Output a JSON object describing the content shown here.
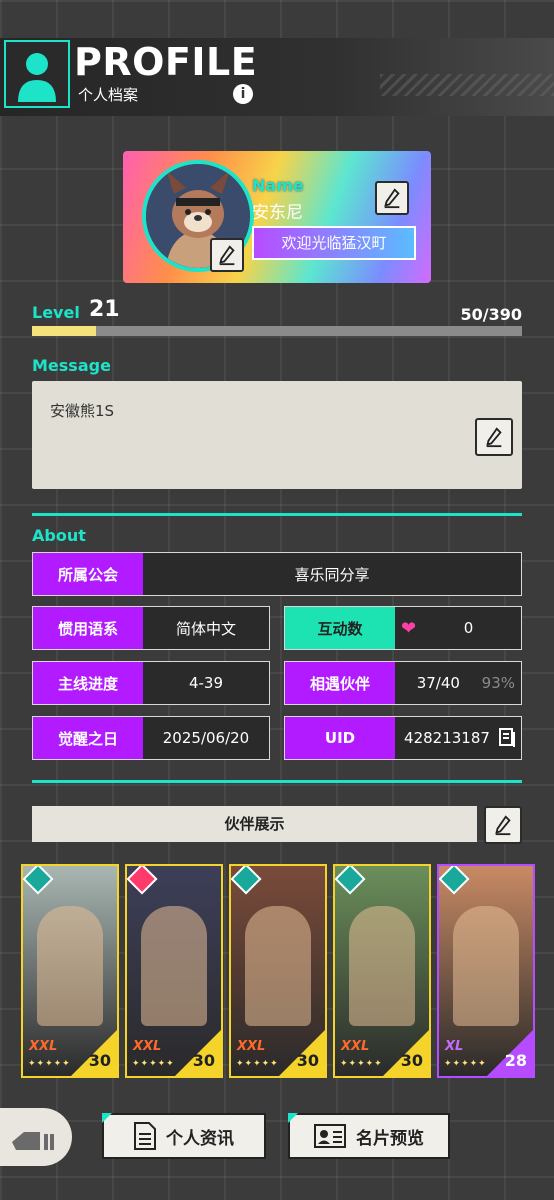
{
  "header": {
    "title": "PROFILE",
    "subtitle": "个人档案",
    "info_glyph": "i"
  },
  "name_card": {
    "name_label": "Name",
    "name_value": "安东尼",
    "greeting": "欢迎光临猛汉町"
  },
  "level": {
    "label": "Level",
    "value": "21",
    "exp_text": "50/390",
    "exp_fraction": 0.13
  },
  "message": {
    "label": "Message",
    "text": "安徽熊1S"
  },
  "about": {
    "label": "About",
    "guild": {
      "key": "所属公会",
      "value": "喜乐同分享"
    },
    "language": {
      "key": "惯用语系",
      "value": "简体中文"
    },
    "interactions": {
      "key": "互动数",
      "value": "0"
    },
    "progress": {
      "key": "主线进度",
      "value": "4-39"
    },
    "partners": {
      "key": "相遇伙伴",
      "value": "37/40",
      "percent": "93%"
    },
    "awaken": {
      "key": "觉醒之日",
      "value": "2025/06/20"
    },
    "uid": {
      "key": "UID",
      "value": "428213187"
    }
  },
  "showcase": {
    "title": "伙伴展示",
    "cards": [
      {
        "size": "XXL",
        "level": "30",
        "badge_color": "#1aa89a",
        "corner_color": "#f4d42a",
        "bg": "#a9b7b2"
      },
      {
        "size": "XXL",
        "level": "30",
        "badge_color": "#ff3b6b",
        "corner_color": "#f4d42a",
        "bg": "#3d3f59"
      },
      {
        "size": "XXL",
        "level": "30",
        "badge_color": "#1aa89a",
        "corner_color": "#f4d42a",
        "bg": "#7a4b3a"
      },
      {
        "size": "XXL",
        "level": "30",
        "badge_color": "#1aa89a",
        "corner_color": "#f4d42a",
        "bg": "#6b8f5a"
      },
      {
        "size": "XL",
        "level": "28",
        "badge_color": "#1aa89a",
        "corner_color": "#b64cff",
        "bg": "#c88a64"
      }
    ]
  },
  "bottom": {
    "info_button": "个人资讯",
    "card_preview_button": "名片预览"
  },
  "colors": {
    "accent": "#1de3c9",
    "purple": "#b21bff",
    "heart": "#ff3fa8"
  }
}
